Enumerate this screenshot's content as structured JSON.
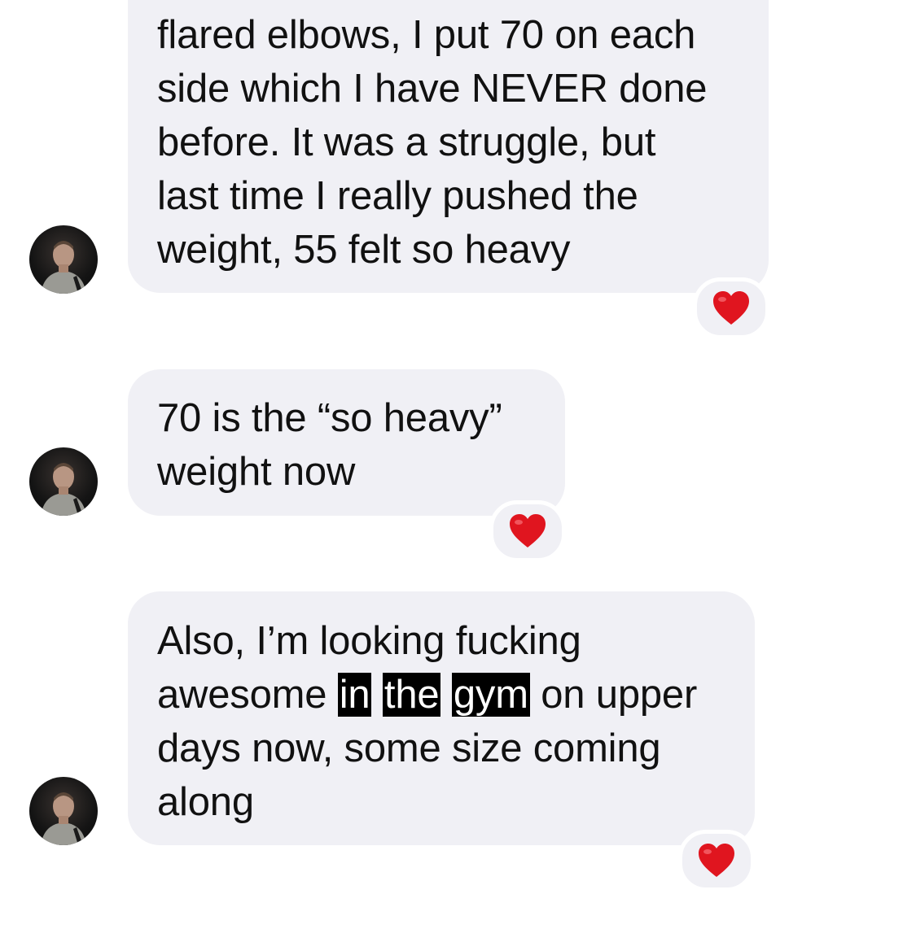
{
  "messages": [
    {
      "lines": [
        "flared elbows, I put 70 on each",
        "side  which I have NEVER done",
        "before. It was a struggle, but",
        "last time I really pushed the",
        "weight, 55 felt so heavy"
      ],
      "reaction": "heart-icon"
    },
    {
      "lines": [
        "70 is the “so heavy”",
        "weight now"
      ],
      "reaction": "heart-icon"
    },
    {
      "line1": "Also, I’m looking fucking",
      "line2_pre": "awesome ",
      "line2_hl": [
        "in",
        "the",
        "gym"
      ],
      "line2_post": " on upper",
      "line3": "days now, some size coming",
      "line4": "along",
      "reaction": "heart-icon"
    }
  ],
  "colors": {
    "bubble": "#f0f0f5",
    "text": "#111111",
    "heart": "#e0151f",
    "highlight": "#000000"
  }
}
